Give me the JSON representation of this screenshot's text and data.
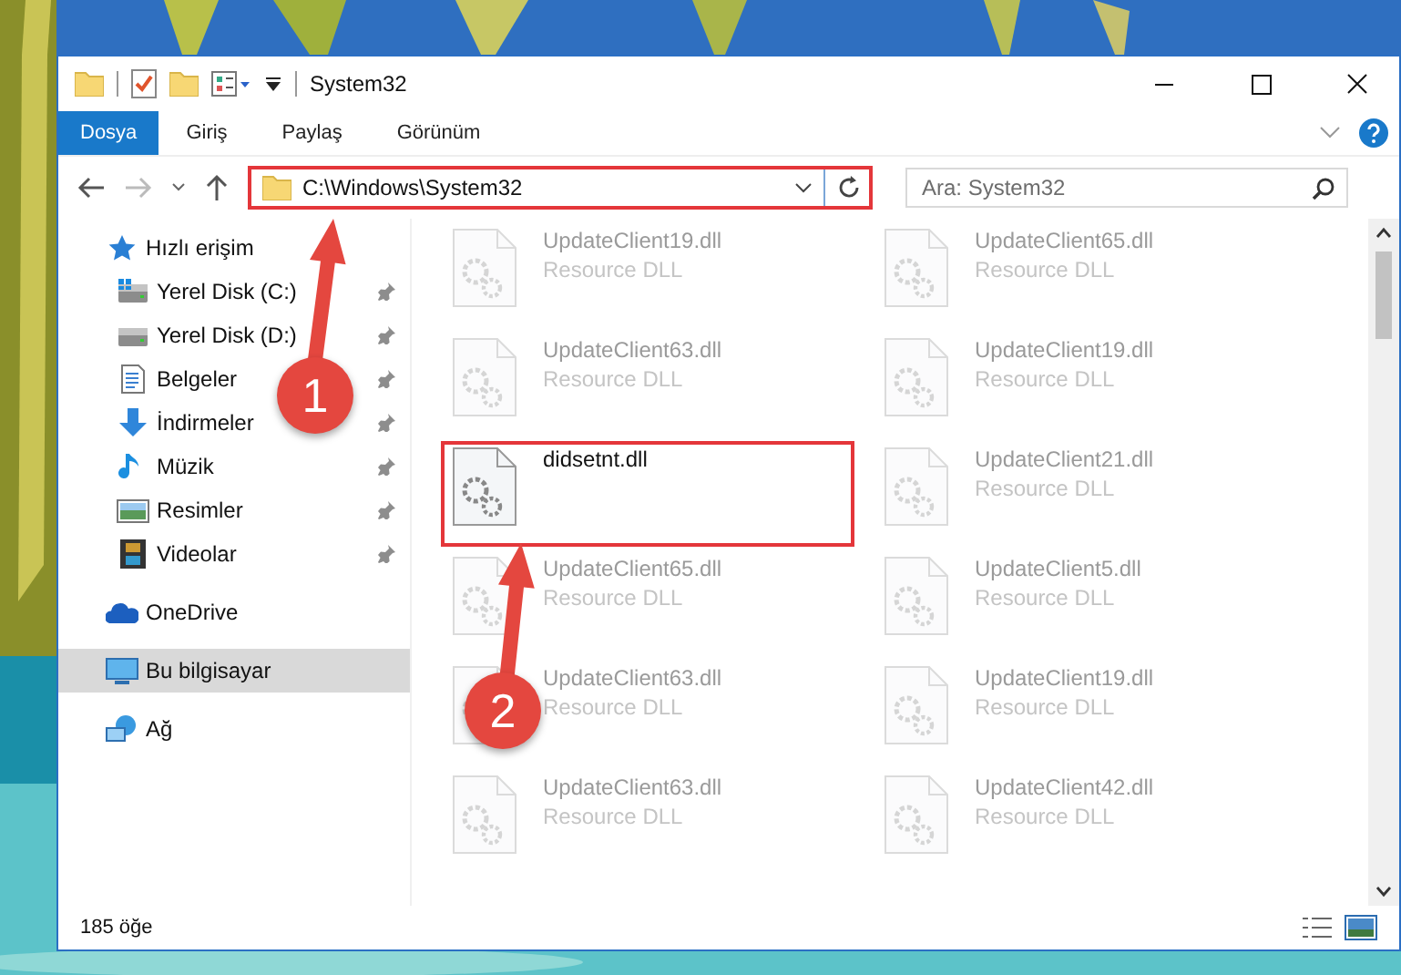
{
  "window": {
    "title": "System32"
  },
  "ribbon_tabs": [
    {
      "label": "Dosya",
      "selected": true
    },
    {
      "label": "Giriş",
      "selected": false
    },
    {
      "label": "Paylaş",
      "selected": false
    },
    {
      "label": "Görünüm",
      "selected": false
    }
  ],
  "address_bar": {
    "path": "C:\\Windows\\System32",
    "highlighted": true
  },
  "search": {
    "placeholder": "Ara: System32"
  },
  "sidebar": {
    "items": [
      {
        "label": "Hızlı erişim",
        "kind": "star",
        "pinned": false,
        "selected": false
      },
      {
        "label": "Yerel Disk (C:)",
        "kind": "disk-win",
        "pinned": true,
        "selected": false
      },
      {
        "label": "Yerel Disk (D:)",
        "kind": "disk",
        "pinned": true,
        "selected": false
      },
      {
        "label": "Belgeler",
        "kind": "docs",
        "pinned": true,
        "selected": false
      },
      {
        "label": "İndirmeler",
        "kind": "download",
        "pinned": true,
        "selected": false
      },
      {
        "label": "Müzik",
        "kind": "music",
        "pinned": true,
        "selected": false
      },
      {
        "label": "Resimler",
        "kind": "pictures",
        "pinned": true,
        "selected": false
      },
      {
        "label": "Videolar",
        "kind": "videos",
        "pinned": true,
        "selected": false
      },
      {
        "label": "OneDrive",
        "kind": "cloud",
        "pinned": false,
        "selected": false
      },
      {
        "label": "Bu bilgisayar",
        "kind": "pc",
        "pinned": false,
        "selected": true
      },
      {
        "label": "Ağ",
        "kind": "network",
        "pinned": false,
        "selected": false
      }
    ]
  },
  "files": [
    {
      "name": "UpdateClient19.dll",
      "type": "Resource DLL",
      "dimmed": true,
      "highlighted": false
    },
    {
      "name": "UpdateClient65.dll",
      "type": "Resource DLL",
      "dimmed": true,
      "highlighted": false
    },
    {
      "name": "UpdateClient63.dll",
      "type": "Resource DLL",
      "dimmed": true,
      "highlighted": false
    },
    {
      "name": "UpdateClient19.dll",
      "type": "Resource DLL",
      "dimmed": true,
      "highlighted": false
    },
    {
      "name": "didsetnt.dll",
      "dimmed": false,
      "highlighted": true
    },
    {
      "name": "UpdateClient21.dll",
      "type": "Resource DLL",
      "dimmed": true,
      "highlighted": false
    },
    {
      "name": "UpdateClient65.dll",
      "type": "Resource DLL",
      "dimmed": true,
      "highlighted": false
    },
    {
      "name": "UpdateClient5.dll",
      "type": "Resource DLL",
      "dimmed": true,
      "highlighted": false
    },
    {
      "name": "UpdateClient63.dll",
      "type": "Resource DLL",
      "dimmed": true,
      "highlighted": false
    },
    {
      "name": "UpdateClient19.dll",
      "type": "Resource DLL",
      "dimmed": true,
      "highlighted": false
    },
    {
      "name": "UpdateClient63.dll",
      "type": "Resource DLL",
      "dimmed": true,
      "highlighted": false
    },
    {
      "name": "UpdateClient42.dll",
      "type": "Resource DLL",
      "dimmed": true,
      "highlighted": false
    }
  ],
  "status_bar": {
    "count": "185 öğe"
  },
  "annotations": [
    {
      "label": "1"
    },
    {
      "label": "2"
    }
  ]
}
